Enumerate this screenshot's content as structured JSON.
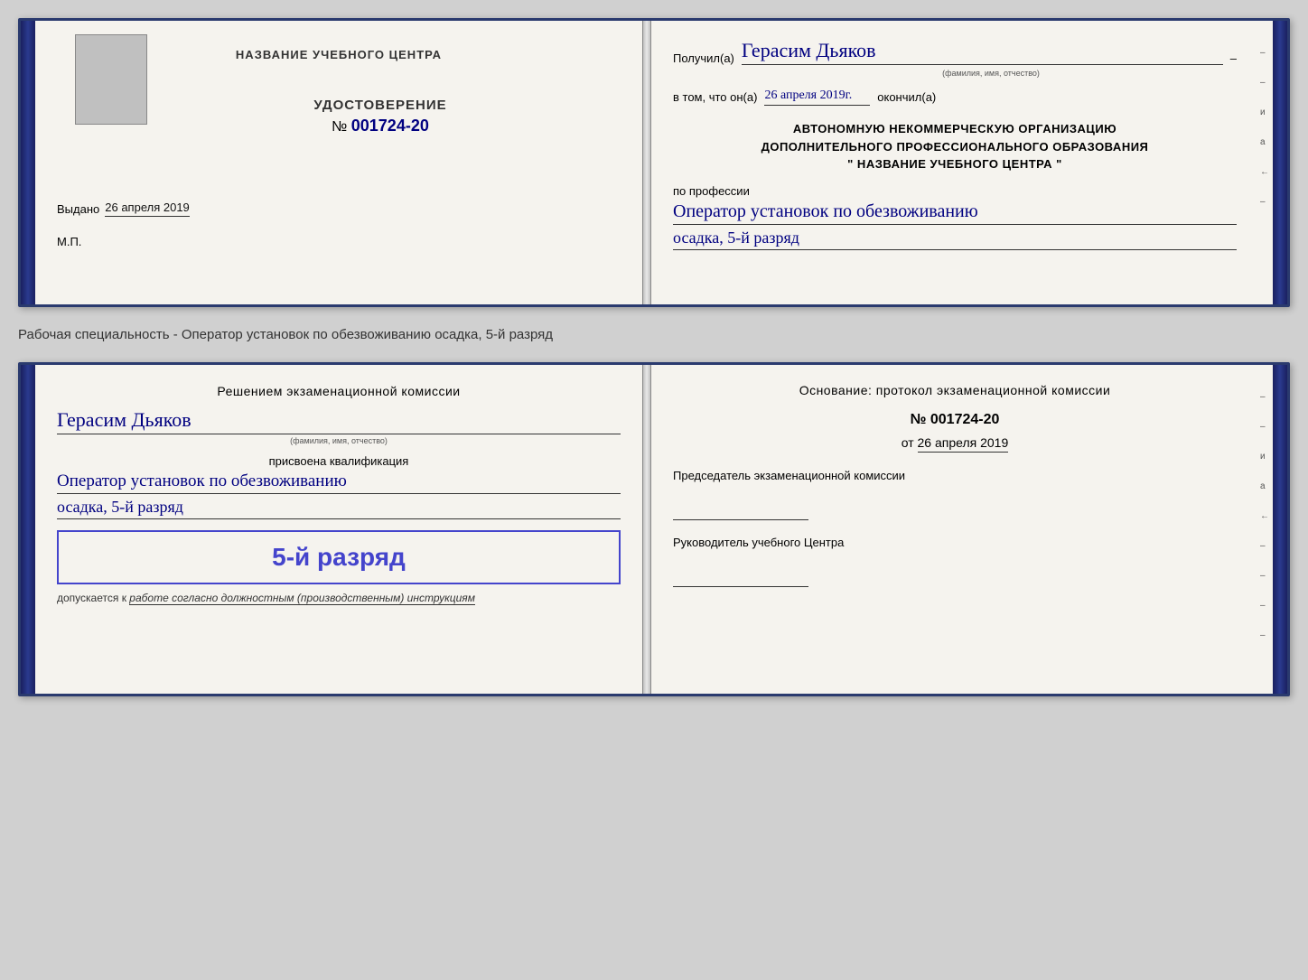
{
  "cert1": {
    "left": {
      "org_name": "НАЗВАНИЕ УЧЕБНОГО ЦЕНТРА",
      "cert_title": "УДОСТОВЕРЕНИЕ",
      "cert_number_prefix": "№",
      "cert_number": "001724-20",
      "issued_label": "Выдано",
      "issued_date": "26 апреля 2019",
      "mp_label": "М.П."
    },
    "right": {
      "recipient_label": "Получил(а)",
      "recipient_name": "Герасим Дьяков",
      "recipient_sublabel": "(фамилия, имя, отчество)",
      "date_prefix": "в том, что он(а)",
      "date_value": "26 апреля 2019г.",
      "date_suffix": "окончил(а)",
      "org_line1": "АВТОНОМНУЮ НЕКОММЕРЧЕСКУЮ ОРГАНИЗАЦИЮ",
      "org_line2": "ДОПОЛНИТЕЛЬНОГО ПРОФЕССИОНАЛЬНОГО ОБРАЗОВАНИЯ",
      "org_line3": "\"  НАЗВАНИЕ УЧЕБНОГО ЦЕНТРА  \"",
      "profession_label": "по профессии",
      "profession_name": "Оператор установок по обезвоживанию",
      "rank": "осадка, 5-й разряд"
    }
  },
  "description": "Рабочая специальность - Оператор установок по обезвоживанию осадка, 5-й разряд",
  "cert2": {
    "left": {
      "decision_line1": "Решением  экзаменационной  комиссии",
      "candidate_name": "Герасим Дьяков",
      "candidate_sublabel": "(фамилия, имя, отчество)",
      "assigned_label": "присвоена квалификация",
      "qualification_name": "Оператор установок по обезвоживанию",
      "qualification_rank": "осадка, 5-й разряд",
      "rank_badge_text": "5-й разряд",
      "allowed_label": "допускается к",
      "allowed_text": "работе согласно должностным (производственным) инструкциям"
    },
    "right": {
      "basis_title": "Основание: протокол экзаменационной  комиссии",
      "protocol_number": "№  001724-20",
      "protocol_date_prefix": "от",
      "protocol_date": "26 апреля 2019",
      "chairman_label": "Председатель экзаменационной комиссии",
      "director_label": "Руководитель учебного Центра"
    }
  },
  "side_marks": [
    "–",
    "–",
    "и",
    "а",
    "←",
    "–",
    "–",
    "–",
    "–"
  ]
}
